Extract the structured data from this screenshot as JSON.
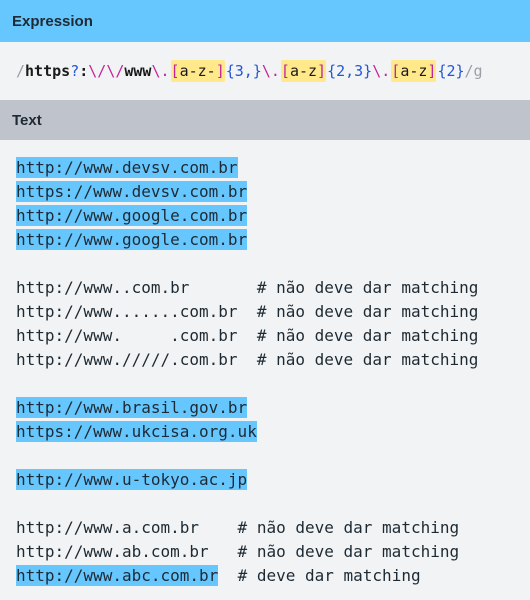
{
  "expression": {
    "header": "Expression",
    "tokens": [
      {
        "type": "delim",
        "text": "/"
      },
      {
        "type": "lit",
        "text": "https"
      },
      {
        "type": "quant",
        "text": "?"
      },
      {
        "type": "lit",
        "text": ":"
      },
      {
        "type": "esc",
        "text": "\\/"
      },
      {
        "type": "esc",
        "text": "\\/"
      },
      {
        "type": "lit",
        "text": "www"
      },
      {
        "type": "esc",
        "text": "\\."
      },
      {
        "type": "cls",
        "text": "a-z-",
        "open": "[",
        "close": "]"
      },
      {
        "type": "quant",
        "text": "{3,}"
      },
      {
        "type": "esc",
        "text": "\\."
      },
      {
        "type": "cls",
        "text": "a-z",
        "open": "[",
        "close": "]"
      },
      {
        "type": "quant",
        "text": "{2,3}"
      },
      {
        "type": "esc",
        "text": "\\."
      },
      {
        "type": "cls",
        "text": "a-z",
        "open": "[",
        "close": "]"
      },
      {
        "type": "quant",
        "text": "{2}"
      },
      {
        "type": "flags",
        "text": "/g"
      }
    ]
  },
  "text": {
    "header": "Text",
    "lines": [
      {
        "match": "http://www.devsv.com.br",
        "rest": ""
      },
      {
        "match": "https://www.devsv.com.br",
        "rest": ""
      },
      {
        "match": "http://www.google.com.br",
        "rest": ""
      },
      {
        "match": "http://www.google.com.br",
        "rest": ""
      },
      {
        "match": "",
        "rest": ""
      },
      {
        "match": "",
        "rest": "http://www..com.br       # não deve dar matching"
      },
      {
        "match": "",
        "rest": "http://www.......com.br  # não deve dar matching"
      },
      {
        "match": "",
        "rest": "http://www.     .com.br  # não deve dar matching"
      },
      {
        "match": "",
        "rest": "http://www./////.com.br  # não deve dar matching"
      },
      {
        "match": "",
        "rest": ""
      },
      {
        "match": "http://www.brasil.gov.br",
        "rest": ""
      },
      {
        "match": "https://www.ukcisa.org.uk",
        "rest": ""
      },
      {
        "match": "",
        "rest": ""
      },
      {
        "match": "http://www.u-tokyo.ac.jp",
        "rest": ""
      },
      {
        "match": "",
        "rest": ""
      },
      {
        "match": "",
        "rest": "http://www.a.com.br    # não deve dar matching"
      },
      {
        "match": "",
        "rest": "http://www.ab.com.br   # não deve dar matching"
      },
      {
        "match": "http://www.abc.com.br",
        "rest": "  # deve dar matching"
      }
    ]
  }
}
